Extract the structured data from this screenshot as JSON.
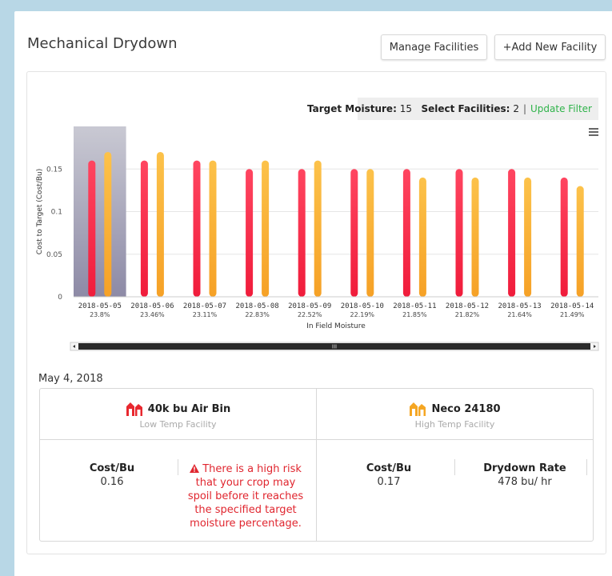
{
  "page": {
    "title": "Mechanical Drydown",
    "buttons": {
      "manage": "Manage Facilities",
      "add": "+Add New Facility"
    }
  },
  "filter": {
    "target_moisture_label": "Target Moisture:",
    "target_moisture_value": "15",
    "select_facilities_label": "Select Facilities:",
    "select_facilities_value": "2",
    "separator": "|",
    "update_link": "Update Filter"
  },
  "chart_data": {
    "type": "bar",
    "ylabel": "Cost to Target (Cost/Bu)",
    "xlabel": "In Field Moisture",
    "ylim": [
      0,
      0.2
    ],
    "yticks": [
      "0",
      "0.05",
      "0.1",
      "0.15"
    ],
    "categories": [
      "2018-05-05",
      "2018-05-06",
      "2018-05-07",
      "2018-05-08",
      "2018-05-09",
      "2018-05-10",
      "2018-05-11",
      "2018-05-12",
      "2018-05-13",
      "2018-05-14"
    ],
    "sublabels": [
      "23.8%",
      "23.46%",
      "23.11%",
      "22.83%",
      "22.52%",
      "22.19%",
      "21.85%",
      "21.82%",
      "21.64%",
      "21.49%"
    ],
    "highlight_index": 0,
    "series": [
      {
        "name": "40k bu Air Bin",
        "color": "#f72d4b",
        "values": [
          0.16,
          0.16,
          0.16,
          0.15,
          0.15,
          0.15,
          0.15,
          0.15,
          0.15,
          0.14
        ]
      },
      {
        "name": "Neco 24180",
        "color": "#fbb33a",
        "values": [
          0.17,
          0.17,
          0.16,
          0.16,
          0.16,
          0.15,
          0.14,
          0.14,
          0.14,
          0.13
        ]
      }
    ],
    "grid": true,
    "scrollbar_thumb_label": "III"
  },
  "detail": {
    "date": "May 4, 2018",
    "left": {
      "icon": "barn-icon",
      "icon_color": "#e8282f",
      "name": "40k bu Air Bin",
      "type": "Low Temp Facility",
      "cost_label": "Cost/Bu",
      "cost_value": "0.16",
      "warning": "There is a high risk that your crop may spoil before it reaches the specified target moisture percentage."
    },
    "right": {
      "icon": "barn-icon",
      "icon_color": "#f5a623",
      "name": "Neco 24180",
      "type": "High Temp Facility",
      "cost_label": "Cost/Bu",
      "cost_value": "0.17",
      "rate_label": "Drydown Rate",
      "rate_value": "478 bu/ hr"
    }
  }
}
